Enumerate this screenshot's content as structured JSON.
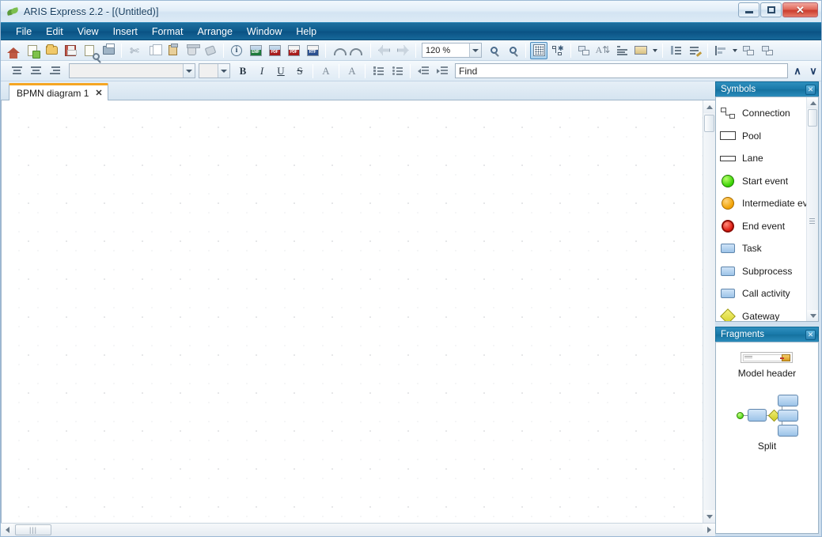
{
  "window": {
    "title": "ARIS Express 2.2 - [(Untitled)]",
    "app_icon": "aris-leaf-icon",
    "minimize_label": "–",
    "maximize_label": "□",
    "close_label": "✕"
  },
  "menubar": {
    "items": [
      {
        "label": "File"
      },
      {
        "label": "Edit"
      },
      {
        "label": "View"
      },
      {
        "label": "Insert"
      },
      {
        "label": "Format"
      },
      {
        "label": "Arrange"
      },
      {
        "label": "Window"
      },
      {
        "label": "Help"
      }
    ]
  },
  "main_toolbar": {
    "buttons": [
      {
        "name": "home-button",
        "icon": "home-icon"
      },
      {
        "name": "new-button",
        "icon": "new-document-icon"
      },
      {
        "name": "open-button",
        "icon": "open-folder-icon"
      },
      {
        "name": "save-button",
        "icon": "floppy-disk-icon"
      },
      {
        "name": "print-preview-button",
        "icon": "page-magnifier-icon"
      },
      {
        "name": "print-button",
        "icon": "printer-icon"
      },
      {
        "name": "cut-button",
        "icon": "scissors-icon"
      },
      {
        "name": "copy-button",
        "icon": "copy-pages-icon"
      },
      {
        "name": "paste-button",
        "icon": "clipboard-icon"
      },
      {
        "name": "delete-button",
        "icon": "trash-icon"
      },
      {
        "name": "format-painter-button",
        "icon": "paintbrush-icon"
      },
      {
        "name": "properties-button",
        "icon": "info-icon"
      },
      {
        "name": "export-emf-button",
        "icon": "emf-export-icon",
        "label": "EMF"
      },
      {
        "name": "export-pdf-button",
        "icon": "pdf-export-icon",
        "label": "PDF"
      },
      {
        "name": "export-pdf-report-button",
        "icon": "pdf-report-icon",
        "label": "PDF"
      },
      {
        "name": "export-rtf-button",
        "icon": "rtf-export-icon",
        "label": "RTF"
      },
      {
        "name": "undo-button",
        "icon": "undo-arrow-icon"
      },
      {
        "name": "redo-button",
        "icon": "redo-arrow-icon"
      },
      {
        "name": "back-button",
        "icon": "back-arrow-icon"
      },
      {
        "name": "forward-button",
        "icon": "forward-arrow-icon"
      }
    ],
    "zoom": {
      "value": "120 %"
    },
    "zoom_in": {
      "name": "zoom-in-button",
      "icon": "magnifier-plus-icon"
    },
    "zoom_out": {
      "name": "zoom-out-button",
      "icon": "magnifier-minus-icon"
    },
    "grid_toggle": {
      "name": "grid-toggle-button",
      "icon": "grid-icon",
      "active": true
    },
    "snap_toggle": {
      "name": "snap-to-grid-button",
      "icon": "snap-connection-icon"
    },
    "right_buttons": [
      {
        "name": "group-button",
        "icon": "group-objects-icon"
      },
      {
        "name": "font-format-button",
        "icon": "font-format-icon"
      },
      {
        "name": "text-align-button",
        "icon": "text-line-icon"
      },
      {
        "name": "fill-color-button",
        "icon": "fill-color-icon"
      },
      {
        "name": "attributes-button",
        "icon": "attributes-icon"
      },
      {
        "name": "edit-attributes-button",
        "icon": "edit-attributes-icon"
      },
      {
        "name": "align-objects-button",
        "icon": "align-left-icon"
      },
      {
        "name": "bring-to-front-button",
        "icon": "bring-front-icon"
      },
      {
        "name": "send-to-back-button",
        "icon": "send-back-icon"
      }
    ]
  },
  "format_toolbar": {
    "align_buttons": [
      {
        "name": "align-top-button",
        "icon": "align-top-icon"
      },
      {
        "name": "align-middle-button",
        "icon": "align-middle-icon"
      },
      {
        "name": "align-bottom-button",
        "icon": "align-bottom-icon"
      }
    ],
    "font_family": {
      "value": "",
      "placeholder": ""
    },
    "font_size": {
      "value": "",
      "placeholder": ""
    },
    "bold": "B",
    "italic": "I",
    "underline": "U",
    "strikethrough": "S",
    "font_color": "A",
    "clear_format": "A",
    "numbered_list": {
      "name": "numbered-list-button"
    },
    "bulleted_list": {
      "name": "bulleted-list-button"
    },
    "decrease_indent": {
      "name": "decrease-indent-button"
    },
    "increase_indent": {
      "name": "increase-indent-button"
    },
    "find": {
      "value": "Find",
      "placeholder": "Find"
    },
    "find_previous": "∧",
    "find_next": "∨"
  },
  "tabs": [
    {
      "label": "BPMN diagram 1",
      "close": "✕",
      "active": true
    }
  ],
  "canvas": {
    "scroll_horizontal_grip": "|||",
    "scroll_up": "▲",
    "scroll_down": "▼",
    "scroll_left": "◄",
    "scroll_right": "►"
  },
  "symbols_panel": {
    "title": "Symbols",
    "close": "✕",
    "items": [
      {
        "label": "Connection",
        "icon": "connection-symbol-icon"
      },
      {
        "label": "Pool",
        "icon": "pool-symbol-icon"
      },
      {
        "label": "Lane",
        "icon": "lane-symbol-icon"
      },
      {
        "label": "Start event",
        "icon": "start-event-symbol-icon",
        "color": "#35d000"
      },
      {
        "label": "Intermediate eve",
        "icon": "intermediate-event-symbol-icon",
        "color": "#f0a000"
      },
      {
        "label": "End event",
        "icon": "end-event-symbol-icon",
        "color": "#e01b10"
      },
      {
        "label": "Task",
        "icon": "task-symbol-icon",
        "color": "#9cc3e8"
      },
      {
        "label": "Subprocess",
        "icon": "subprocess-symbol-icon",
        "color": "#9cc3e8"
      },
      {
        "label": "Call activity",
        "icon": "call-activity-symbol-icon",
        "color": "#9cc3e8"
      },
      {
        "label": "Gateway",
        "icon": "gateway-symbol-icon",
        "color": "#d6d22a"
      }
    ]
  },
  "fragments_panel": {
    "title": "Fragments",
    "close": "✕",
    "items": [
      {
        "label": "Model header",
        "icon": "model-header-fragment-icon"
      },
      {
        "label": "Split",
        "icon": "split-fragment-icon"
      }
    ]
  },
  "colors": {
    "menubar": "#0d5b8c",
    "panel_header": "#1878a8",
    "tab_accent": "#f5a623",
    "title_text": "#143c5e",
    "close_button": "#cb3d2e"
  }
}
